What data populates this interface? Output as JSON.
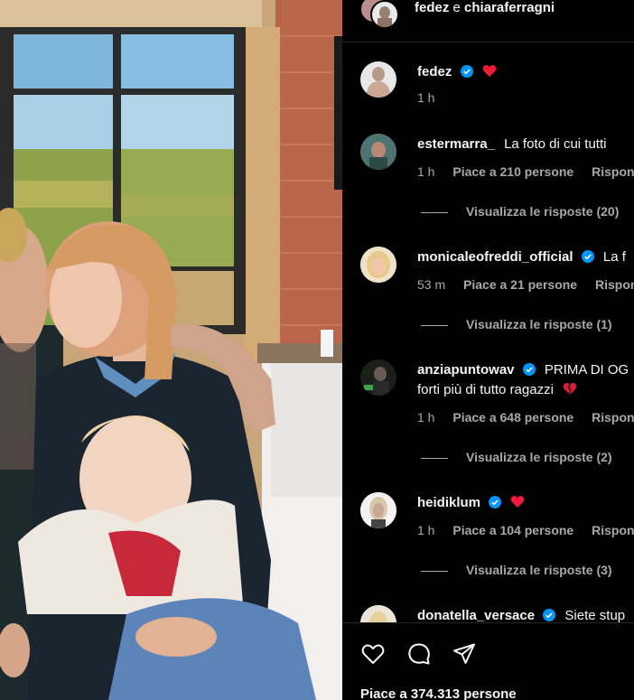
{
  "header": {
    "user1": "fedez",
    "conjunction": "e",
    "user2": "chiaraferragni"
  },
  "caption": {
    "username": "fedez",
    "time": "1 h"
  },
  "comments": [
    {
      "username": "estermarra_",
      "text": "La foto di cui tutti",
      "text2": "",
      "verified": false,
      "heart": false,
      "time": "1 h",
      "likes": "Piace a 210 persone",
      "reply": "Rispondi",
      "replies": "Visualizza le risposte (20)"
    },
    {
      "username": "monicaleofreddi_official",
      "text": "La f",
      "text2": "",
      "verified": true,
      "heart": false,
      "time": "53 m",
      "likes": "Piace a 21 persone",
      "reply": "Rispondi",
      "replies": "Visualizza le risposte (1)"
    },
    {
      "username": "anziapuntowav",
      "text": "PRIMA DI OG",
      "text2": "forti più di tutto ragazzi",
      "verified": true,
      "heart": false,
      "time": "1 h",
      "likes": "Piace a 648 persone",
      "reply": "Rispondi",
      "replies": "Visualizza le risposte (2)"
    },
    {
      "username": "heidiklum",
      "text": "",
      "text2": "",
      "verified": true,
      "heart": true,
      "time": "1 h",
      "likes": "Piace a 104 persone",
      "reply": "Rispondi",
      "replies": "Visualizza le risposte (3)"
    },
    {
      "username": "donatella_versace",
      "text": "Siete stup",
      "verified": true
    }
  ],
  "footer": {
    "likes": "Piace a 374.313 persone"
  },
  "icons": {
    "like": "heart-outline-icon",
    "comment": "comment-bubble-icon",
    "share": "paper-plane-icon",
    "verified": "verified-badge-icon",
    "red_heart": "red-heart-emoji"
  },
  "colors": {
    "background": "#000000",
    "text": "#f5f5f5",
    "secondary": "#a8a8a8",
    "verified": "#0095f6",
    "heart": "#ed1c3a"
  }
}
